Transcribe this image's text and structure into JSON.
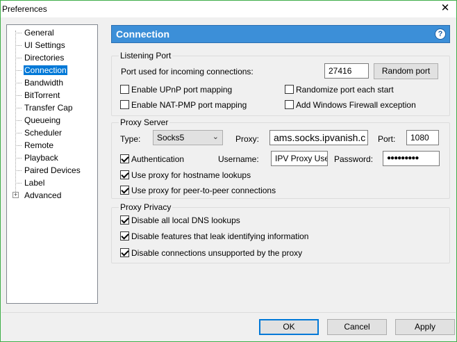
{
  "window": {
    "title": "Preferences",
    "close_glyph": "✕"
  },
  "sidebar": {
    "items": [
      {
        "label": "General"
      },
      {
        "label": "UI Settings"
      },
      {
        "label": "Directories"
      },
      {
        "label": "Connection",
        "selected": true
      },
      {
        "label": "Bandwidth"
      },
      {
        "label": "BitTorrent"
      },
      {
        "label": "Transfer Cap"
      },
      {
        "label": "Queueing"
      },
      {
        "label": "Scheduler"
      },
      {
        "label": "Remote"
      },
      {
        "label": "Playback"
      },
      {
        "label": "Paired Devices"
      },
      {
        "label": "Label"
      },
      {
        "label": "Advanced",
        "expandable": true
      }
    ]
  },
  "header": {
    "title": "Connection",
    "help": "?"
  },
  "listening": {
    "title": "Listening Port",
    "port_label": "Port used for incoming connections:",
    "port_value": "27416",
    "random_button": "Random port",
    "upnp": {
      "label": "Enable UPnP port mapping",
      "checked": false
    },
    "natpmp": {
      "label": "Enable NAT-PMP port mapping",
      "checked": false
    },
    "randomize": {
      "label": "Randomize port each start",
      "checked": false
    },
    "firewall": {
      "label": "Add Windows Firewall exception",
      "checked": false
    }
  },
  "proxy": {
    "title": "Proxy Server",
    "type_label": "Type:",
    "type_value": "Socks5",
    "proxy_label": "Proxy:",
    "proxy_value": "ams.socks.ipvanish.c",
    "port_label": "Port:",
    "port_value": "1080",
    "auth": {
      "label": "Authentication",
      "checked": true
    },
    "username_label": "Username:",
    "username_value": "IPV Proxy User",
    "password_label": "Password:",
    "password_value": "●●●●●●●●●",
    "hostname": {
      "label": "Use proxy for hostname lookups",
      "checked": true
    },
    "p2p": {
      "label": "Use proxy for peer-to-peer connections",
      "checked": true
    }
  },
  "privacy": {
    "title": "Proxy Privacy",
    "dns": {
      "label": "Disable all local DNS lookups",
      "checked": true
    },
    "leak": {
      "label": "Disable features that leak identifying information",
      "checked": true
    },
    "unsupported": {
      "label": "Disable connections unsupported by the proxy",
      "checked": true
    }
  },
  "footer": {
    "ok": "OK",
    "cancel": "Cancel",
    "apply": "Apply"
  },
  "colors": {
    "accent": "#3c8fd8",
    "selected": "#0078d7",
    "window_border": "#3fae49"
  }
}
